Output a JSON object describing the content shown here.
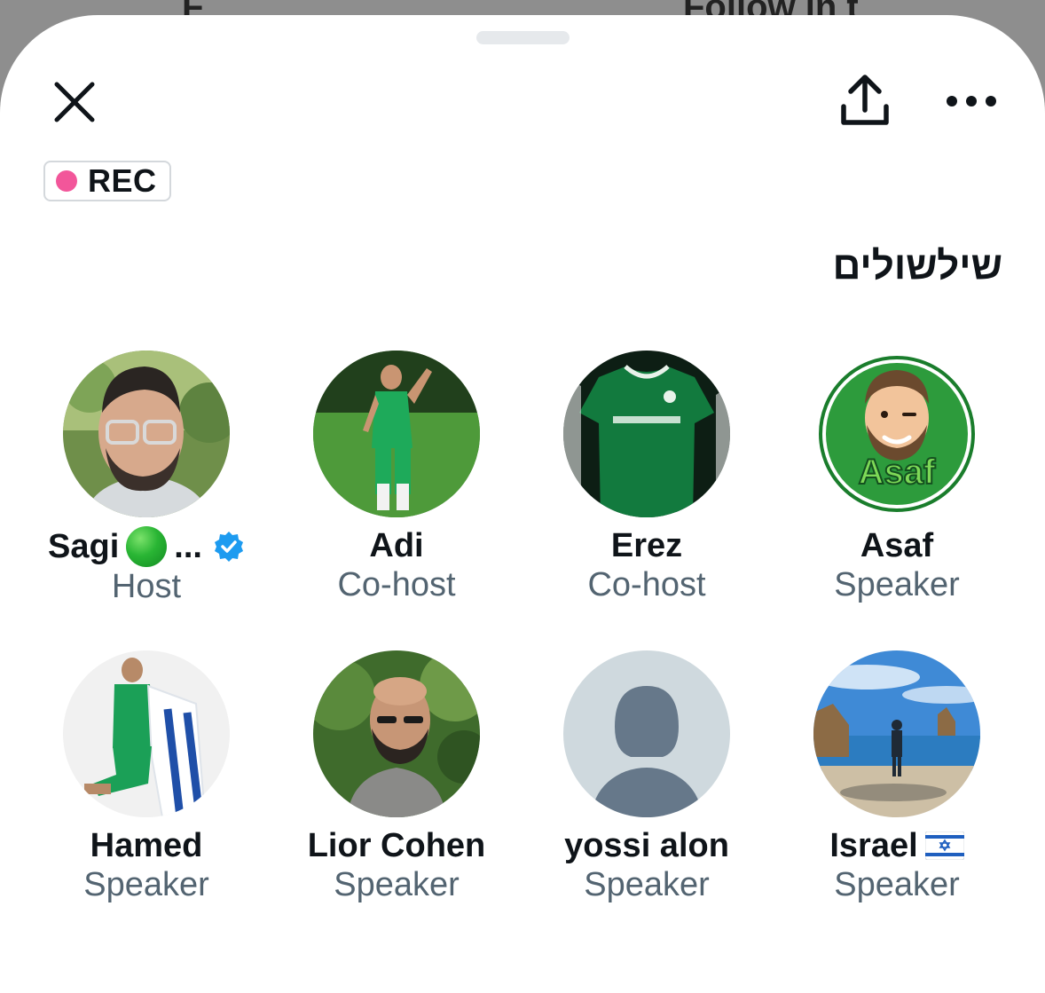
{
  "backdrop": {
    "left_text": "F",
    "right_text": "Follow in t"
  },
  "header": {
    "close_icon": "close-icon",
    "share_icon": "share-icon",
    "more_icon": "more-icon"
  },
  "rec_badge": {
    "label": "REC",
    "dot_color": "#f2569a"
  },
  "space": {
    "title": "שילשולים"
  },
  "participants": [
    {
      "name": "Sagi",
      "name_suffix": "...",
      "role": "Host",
      "verified": true,
      "emoji": "green-circle"
    },
    {
      "name": "Adi",
      "role": "Co-host"
    },
    {
      "name": "Erez",
      "role": "Co-host"
    },
    {
      "name": "Asaf",
      "role": "Speaker",
      "avatar_text": "Asaf"
    },
    {
      "name": "Hamed",
      "role": "Speaker"
    },
    {
      "name": "Lior Cohen",
      "role": "Speaker"
    },
    {
      "name": "yossi alon",
      "role": "Speaker",
      "avatar": "default-avatar"
    },
    {
      "name": "Israel",
      "role": "Speaker",
      "emoji": "israel-flag"
    }
  ],
  "colors": {
    "text_primary": "#0f1419",
    "text_secondary": "#536471",
    "verified_blue": "#1d9bf0"
  }
}
